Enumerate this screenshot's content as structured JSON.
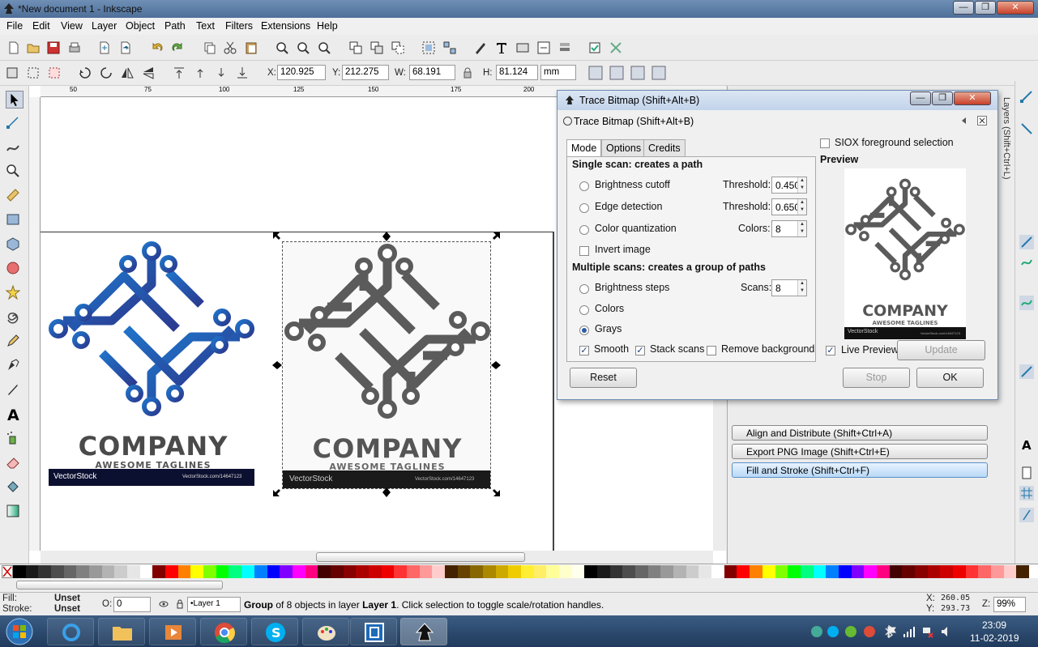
{
  "window": {
    "title": "*New document 1 - Inkscape",
    "min": "—",
    "max": "❐",
    "close": "✕"
  },
  "menu": [
    "File",
    "Edit",
    "View",
    "Layer",
    "Object",
    "Path",
    "Text",
    "Filters",
    "Extensions",
    "Help"
  ],
  "toolbar2": {
    "x_label": "X:",
    "x": "120.925",
    "y_label": "Y:",
    "y": "212.275",
    "w_label": "W:",
    "w": "68.191",
    "h_label": "H:",
    "h": "81.124",
    "unit": "mm"
  },
  "ruler": {
    "ticks": [
      "50",
      "75",
      "100",
      "125",
      "150",
      "175",
      "200"
    ]
  },
  "canvas": {
    "left_logo": {
      "company": "COMPANY",
      "tagline": "AWESOME TAGLINES",
      "brand": "VectorStock",
      "url": "VectorStock.com/14647123"
    },
    "right_logo": {
      "company": "COMPANY",
      "tagline": "AWESOME TAGLINES",
      "brand": "VectorStock",
      "url": "VectorStock.com/14647123"
    }
  },
  "dock": {
    "align": "Align and Distribute (Shift+Ctrl+A)",
    "export": "Export PNG Image (Shift+Ctrl+E)",
    "fill": "Fill and Stroke (Shift+Ctrl+F)",
    "side_tab": "Layers (Shift+Ctrl+L)"
  },
  "dialog": {
    "window_title": "Trace Bitmap (Shift+Alt+B)",
    "inner_title": "Trace Bitmap (Shift+Alt+B)",
    "tabs": [
      "Mode",
      "Options",
      "Credits"
    ],
    "single_header": "Single scan: creates a path",
    "brightness": "Brightness cutoff",
    "threshold_label": "Threshold:",
    "threshold1": "0.450",
    "edge": "Edge detection",
    "threshold2": "0.650",
    "color_quant": "Color quantization",
    "colors_label": "Colors:",
    "colors_value": "8",
    "invert": "Invert image",
    "multi_header": "Multiple scans: creates a group of paths",
    "brightness_steps": "Brightness steps",
    "scans_label": "Scans:",
    "scans_value": "8",
    "colors": "Colors",
    "grays": "Grays",
    "smooth": "Smooth",
    "stack": "Stack scans",
    "remove_bg": "Remove background",
    "siox": "SIOX foreground selection",
    "preview": "Preview",
    "live_preview": "Live Preview",
    "update": "Update",
    "reset": "Reset",
    "stop": "Stop",
    "ok": "OK",
    "preview_logo": {
      "company": "COMPANY",
      "tagline": "AWESOME TAGLINES",
      "brand": "VectorStock",
      "url": "VectorStock.com/14647123"
    }
  },
  "status": {
    "fill_label": "Fill:",
    "fill_value": "Unset",
    "stroke_label": "Stroke:",
    "stroke_value": "Unset",
    "opacity_label": "O:",
    "opacity_value": "0",
    "layer": "•Layer 1",
    "msg_group": "Group",
    "msg_of": " of 8 objects in layer ",
    "msg_layer": "Layer 1",
    "msg_rest": ". Click selection to toggle scale/rotation handles.",
    "x_label": "X:",
    "x": "260.05",
    "y_label": "Y:",
    "y": "293.73",
    "zoom_label": "Z:",
    "zoom": "99%"
  },
  "taskbar": {
    "time": "23:09",
    "date": "11-02-2019"
  },
  "colors": {
    "accent_blue": "#1f4fa0",
    "logo_gray": "#5b5b5b"
  }
}
